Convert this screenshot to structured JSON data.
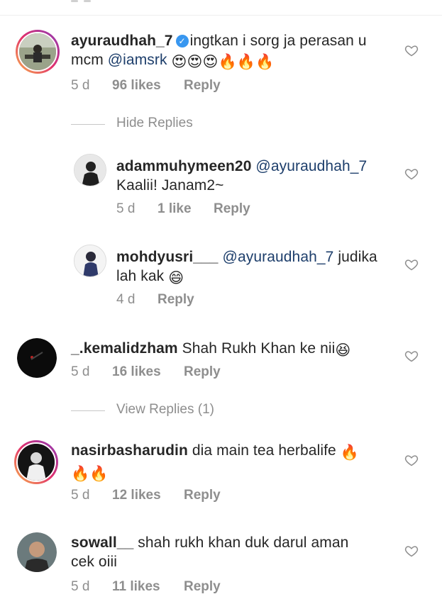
{
  "comments": [
    {
      "username": "ayuraudhah_7",
      "verified": true,
      "text_a": "ingtkan i sorg ja perasan u",
      "text_b": "mcm ",
      "mention": "@iamsrk",
      "emojis": "😍😍😍🔥🔥🔥",
      "time": "5 d",
      "likes": "96 likes",
      "reply": "Reply",
      "toggle": "Hide Replies",
      "replies": [
        {
          "username": "adammuhymeen20",
          "mention": "@ayuraudhah_7",
          "text": "Kaalii! Janam2~",
          "time": "5 d",
          "likes": "1 like",
          "reply": "Reply"
        },
        {
          "username": "mohdyusri___",
          "mention": "@ayuraudhah_7",
          "text_a": " judika",
          "text_b": "lah kak ",
          "emojis": "😄",
          "time": "4 d",
          "reply": "Reply"
        }
      ]
    },
    {
      "username": "_.kemalidzham",
      "text": " Shah Rukh Khan ke nii",
      "emojis": "😆",
      "time": "5 d",
      "likes": "16 likes",
      "reply": "Reply",
      "toggle": "View Replies (1)"
    },
    {
      "username": "nasirbasharudin",
      "text": " dia main tea herbalife ",
      "emojis_a": "🔥",
      "emojis_b": "🔥🔥",
      "time": "5 d",
      "likes": "12 likes",
      "reply": "Reply"
    },
    {
      "username": "sowall__",
      "text_a": " shah rukh khan duk darul aman",
      "text_b": "cek oiii",
      "time": "5 d",
      "likes": "11 likes",
      "reply": "Reply"
    }
  ],
  "icons": {
    "like": "heart-outline-icon",
    "verified": "verified-badge-icon"
  },
  "colors": {
    "mention": "#1d3e6b",
    "meta": "#8e8e8e",
    "verified": "#3897f0"
  }
}
